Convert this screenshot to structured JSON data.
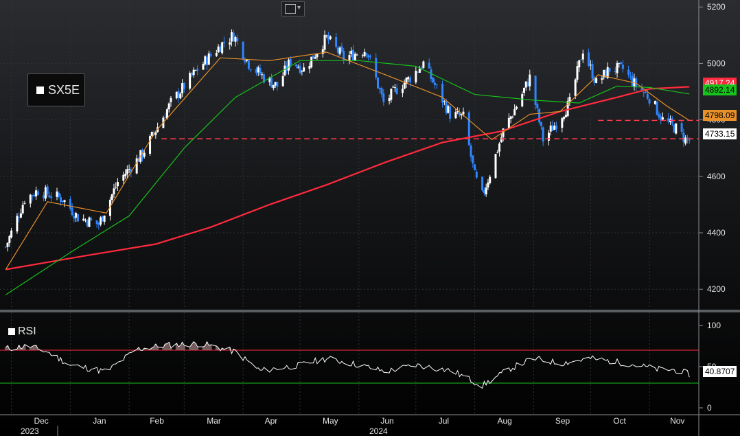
{
  "chart_data": [
    {
      "type": "candlestick",
      "title": "SX5E",
      "x_month_labels": [
        "Dec",
        "Jan",
        "Feb",
        "Mar",
        "Apr",
        "May",
        "Jun",
        "Jul",
        "Aug",
        "Sep",
        "Oct",
        "Nov"
      ],
      "x_year_labels": [
        "2023",
        "2024"
      ],
      "y_ticks": [
        4200,
        4400,
        4600,
        4800,
        5000,
        5200
      ],
      "ylim": [
        4130,
        5220
      ],
      "close_points": [
        [
          "2023-11-28",
          4350
        ],
        [
          "2023-12-08",
          4520
        ],
        [
          "2023-12-15",
          4550
        ],
        [
          "2023-12-28",
          4520
        ],
        [
          "2024-01-05",
          4455
        ],
        [
          "2024-01-16",
          4430
        ],
        [
          "2024-01-26",
          4580
        ],
        [
          "2024-02-08",
          4680
        ],
        [
          "2024-02-23",
          4860
        ],
        [
          "2024-03-08",
          4980
        ],
        [
          "2024-03-21",
          5070
        ],
        [
          "2024-03-27",
          5100
        ],
        [
          "2024-04-04",
          5000
        ],
        [
          "2024-04-12",
          4950
        ],
        [
          "2024-04-19",
          4920
        ],
        [
          "2024-04-26",
          5010
        ],
        [
          "2024-05-03",
          4980
        ],
        [
          "2024-05-15",
          5090
        ],
        [
          "2024-05-24",
          5020
        ],
        [
          "2024-06-05",
          5050
        ],
        [
          "2024-06-14",
          4860
        ],
        [
          "2024-06-21",
          4910
        ],
        [
          "2024-06-28",
          4950
        ],
        [
          "2024-07-05",
          5000
        ],
        [
          "2024-07-12",
          4910
        ],
        [
          "2024-07-19",
          4820
        ],
        [
          "2024-07-26",
          4810
        ],
        [
          "2024-08-01",
          4600
        ],
        [
          "2024-08-05",
          4530
        ],
        [
          "2024-08-09",
          4610
        ],
        [
          "2024-08-16",
          4760
        ],
        [
          "2024-08-23",
          4850
        ],
        [
          "2024-08-30",
          4950
        ],
        [
          "2024-09-06",
          4730
        ],
        [
          "2024-09-13",
          4790
        ],
        [
          "2024-09-20",
          4860
        ],
        [
          "2024-09-27",
          5050
        ],
        [
          "2024-10-04",
          4930
        ],
        [
          "2024-10-11",
          4980
        ],
        [
          "2024-10-18",
          4980
        ],
        [
          "2024-10-25",
          4920
        ],
        [
          "2024-11-01",
          4880
        ],
        [
          "2024-11-08",
          4800
        ],
        [
          "2024-11-15",
          4770
        ],
        [
          "2024-11-20",
          4730
        ],
        [
          "2024-11-22",
          4730.15
        ]
      ],
      "ma_points_200": [
        [
          "2023-11-28",
          4270
        ],
        [
          "2024-01-10",
          4320
        ],
        [
          "2024-02-15",
          4360
        ],
        [
          "2024-03-15",
          4420
        ],
        [
          "2024-04-15",
          4500
        ],
        [
          "2024-05-15",
          4570
        ],
        [
          "2024-06-15",
          4650
        ],
        [
          "2024-07-15",
          4720
        ],
        [
          "2024-08-15",
          4760
        ],
        [
          "2024-09-15",
          4830
        ],
        [
          "2024-10-15",
          4880
        ],
        [
          "2024-11-01",
          4910
        ],
        [
          "2024-11-22",
          4917.24
        ]
      ],
      "ma_points_50": [
        [
          "2023-11-28",
          4180
        ],
        [
          "2024-01-01",
          4330
        ],
        [
          "2024-02-01",
          4460
        ],
        [
          "2024-03-01",
          4700
        ],
        [
          "2024-03-28",
          4880
        ],
        [
          "2024-05-01",
          5010
        ],
        [
          "2024-06-01",
          5010
        ],
        [
          "2024-07-01",
          4990
        ],
        [
          "2024-08-01",
          4890
        ],
        [
          "2024-09-01",
          4870
        ],
        [
          "2024-09-25",
          4860
        ],
        [
          "2024-10-15",
          4920
        ],
        [
          "2024-11-01",
          4915
        ],
        [
          "2024-11-22",
          4892.14
        ]
      ],
      "ma_points_20": [
        [
          "2023-11-28",
          4270
        ],
        [
          "2023-12-20",
          4510
        ],
        [
          "2024-01-20",
          4470
        ],
        [
          "2024-02-15",
          4760
        ],
        [
          "2024-03-20",
          5020
        ],
        [
          "2024-04-15",
          5010
        ],
        [
          "2024-05-15",
          5040
        ],
        [
          "2024-06-15",
          4960
        ],
        [
          "2024-07-15",
          4880
        ],
        [
          "2024-08-10",
          4730
        ],
        [
          "2024-08-30",
          4820
        ],
        [
          "2024-09-15",
          4830
        ],
        [
          "2024-10-05",
          4960
        ],
        [
          "2024-10-25",
          4930
        ],
        [
          "2024-11-10",
          4850
        ],
        [
          "2024-11-22",
          4798.09
        ]
      ],
      "support_level": 4733.15,
      "resistance_level": 4798.09,
      "value_labels": {
        "ma200": "4917.24",
        "ma50": "4892.14",
        "ma20": "4798.09",
        "last": "4733.15"
      },
      "colors": {
        "up": "#ffffff",
        "down": "#2f86ff",
        "ma200": "#ff2a3d",
        "ma50": "#18c21c",
        "ma20": "#e8902a",
        "dashed": "#ff3b4b",
        "grid": "#2f3236"
      }
    },
    {
      "type": "line",
      "title": "RSI",
      "y_ticks": [
        0,
        50,
        100
      ],
      "ylim": [
        -5,
        110
      ],
      "overbought": 70,
      "oversold": 30,
      "current": "40.8707",
      "points": [
        [
          "2023-11-28",
          72
        ],
        [
          "2023-12-10",
          75
        ],
        [
          "2023-12-20",
          68
        ],
        [
          "2024-01-01",
          52
        ],
        [
          "2024-01-20",
          44
        ],
        [
          "2024-02-05",
          71
        ],
        [
          "2024-02-20",
          76
        ],
        [
          "2024-03-10",
          78
        ],
        [
          "2024-03-28",
          68
        ],
        [
          "2024-04-10",
          45
        ],
        [
          "2024-05-01",
          52
        ],
        [
          "2024-05-15",
          60
        ],
        [
          "2024-06-01",
          52
        ],
        [
          "2024-06-15",
          44
        ],
        [
          "2024-07-01",
          52
        ],
        [
          "2024-07-20",
          45
        ],
        [
          "2024-08-05",
          27
        ],
        [
          "2024-08-20",
          48
        ],
        [
          "2024-09-01",
          60
        ],
        [
          "2024-09-15",
          54
        ],
        [
          "2024-10-01",
          60
        ],
        [
          "2024-10-20",
          54
        ],
        [
          "2024-11-05",
          47
        ],
        [
          "2024-11-15",
          46
        ],
        [
          "2024-11-22",
          40.87
        ]
      ],
      "colors": {
        "line": "#ffffff",
        "overbought": "#ff2a3d",
        "oversold": "#18c21c",
        "shade": "#a07a7e"
      }
    }
  ]
}
